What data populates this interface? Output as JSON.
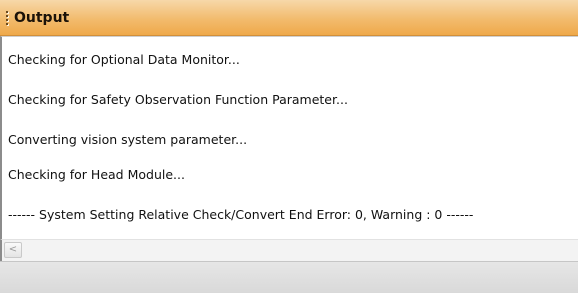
{
  "panel": {
    "title": "Output",
    "grip_icon": "grip-dots-icon"
  },
  "output": {
    "lines": [
      "Checking for Optional Data Monitor...",
      "Checking for Safety Observation Function Parameter...",
      "Converting vision system parameter...",
      "Checking for Head Module...",
      "------ System Setting Relative Check/Convert End   Error: 0, Warning : 0 ------"
    ]
  },
  "scrollbar": {
    "left_arrow_icon": "chevron-left-icon",
    "left_arrow_glyph": "<"
  },
  "colors": {
    "title_bar": "#f2bb6d",
    "title_bar_border": "#d18f3a",
    "text": "#111111"
  }
}
